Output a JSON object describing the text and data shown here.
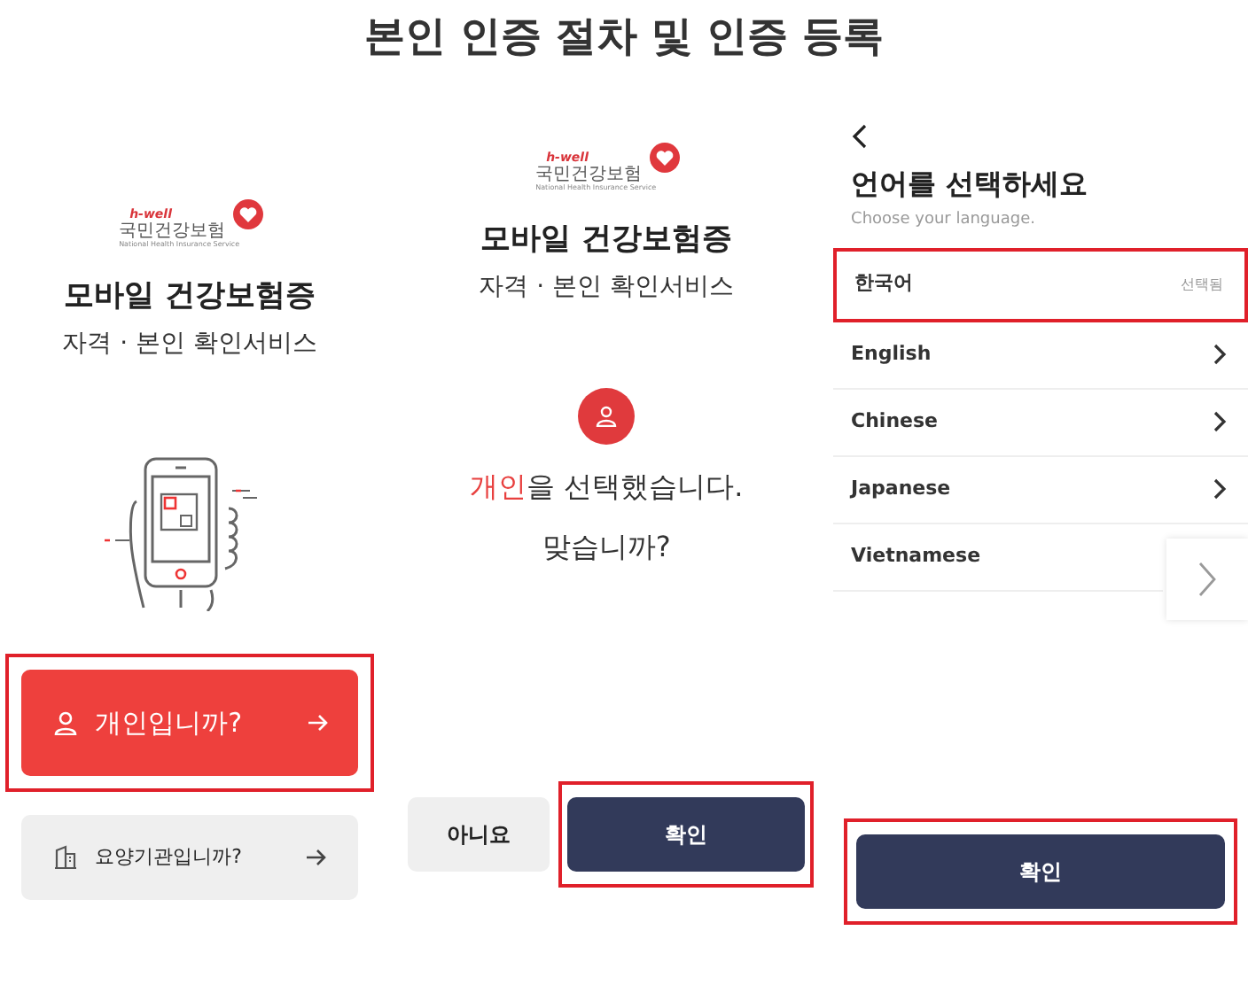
{
  "title": "본인 인증 절차 및 인증 등록",
  "screen_1": {
    "logo": {
      "tagline": "h-well",
      "name": "국민건강보험",
      "subtitle": "National Health Insurance Service"
    },
    "heading": "모바일 건강보험증",
    "subheading": "자격 · 본인 확인서비스",
    "options": [
      {
        "kind": "primary",
        "label": "개인입니까?",
        "highlighted": true
      },
      {
        "kind": "secondary",
        "label": "요양기관입니까?",
        "highlighted": false
      }
    ]
  },
  "screen_2": {
    "logo": {
      "tagline": "h-well",
      "name": "국민건강보험",
      "subtitle": "National Health Insurance Service"
    },
    "heading": "모바일 건강보험증",
    "subheading": "자격 · 본인 확인서비스",
    "message": "**개인**을 선택했습니다.",
    "question": "맞습니까?",
    "buttons": [
      {
        "kind": "secondary",
        "label": "아니요",
        "highlighted": false
      },
      {
        "kind": "primary",
        "label": "확인",
        "highlighted": true
      }
    ]
  },
  "screen_3": {
    "heading": "언어를 선택하세요",
    "subheading": "Choose your language.",
    "languages": [
      {
        "label": "한국어",
        "selected": true,
        "status": "선택됨"
      },
      {
        "label": "English",
        "selected": false
      },
      {
        "label": "Chinese",
        "selected": false
      },
      {
        "label": "Japanese",
        "selected": false
      },
      {
        "label": "Vietnamese",
        "selected": false
      }
    ],
    "button": {
      "label": "확인",
      "highlighted": true
    }
  }
}
